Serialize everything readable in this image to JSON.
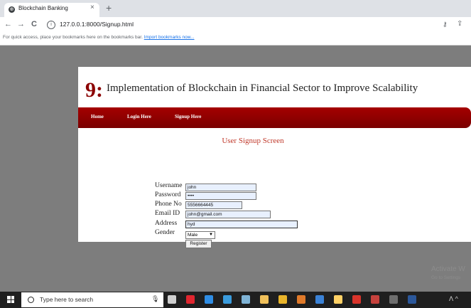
{
  "browser": {
    "tab_title": "Blockchain Banking",
    "tab_close": "×",
    "new_tab": "+",
    "back": "←",
    "forward": "→",
    "reload": "C",
    "url": "127.0.0.1:8000/Signup.html",
    "bookmarks_hint": "For quick access, place your bookmarks here on the bookmarks bar.",
    "import_link": "Import bookmarks now..."
  },
  "site": {
    "logo_glyph": "9:",
    "title": "Implementation of Blockchain in Financial Sector to Improve Scalability",
    "nav": [
      {
        "label": "Home"
      },
      {
        "label": "Login Here"
      },
      {
        "label": "Signup Here"
      }
    ]
  },
  "form": {
    "heading": "User Signup Screen",
    "fields": {
      "username": {
        "label": "Username",
        "value": "john"
      },
      "password": {
        "label": "Password",
        "value": "••••"
      },
      "phone": {
        "label": "Phone No",
        "value": "5556664445"
      },
      "email": {
        "label": "Email ID",
        "value": "john@gmail.com"
      },
      "address": {
        "label": "Address",
        "value": "hyd"
      },
      "gender": {
        "label": "Gender",
        "value": "Male"
      }
    },
    "register_label": "Register"
  },
  "watermark": {
    "line1": "Activate W",
    "line2": "Go to Settings"
  },
  "taskbar": {
    "search_placeholder": "Type here to search",
    "icons": [
      {
        "name": "task-view",
        "color": "#cfcfcf"
      },
      {
        "name": "opera",
        "color": "#e0262f"
      },
      {
        "name": "edge",
        "color": "#2f8de4"
      },
      {
        "name": "explorer",
        "color": "#3a9bdc"
      },
      {
        "name": "notepad",
        "color": "#7fb3d5"
      },
      {
        "name": "store",
        "color": "#f0c05a"
      },
      {
        "name": "chrome",
        "color": "#e9b42a"
      },
      {
        "name": "paint",
        "color": "#e07a2a"
      },
      {
        "name": "photos",
        "color": "#3b82d6"
      },
      {
        "name": "files",
        "color": "#ffd166"
      },
      {
        "name": "pdf",
        "color": "#d9342b"
      },
      {
        "name": "app",
        "color": "#c6423d"
      },
      {
        "name": "terminal",
        "color": "#6e6e6e"
      },
      {
        "name": "word",
        "color": "#2b579a"
      }
    ]
  }
}
